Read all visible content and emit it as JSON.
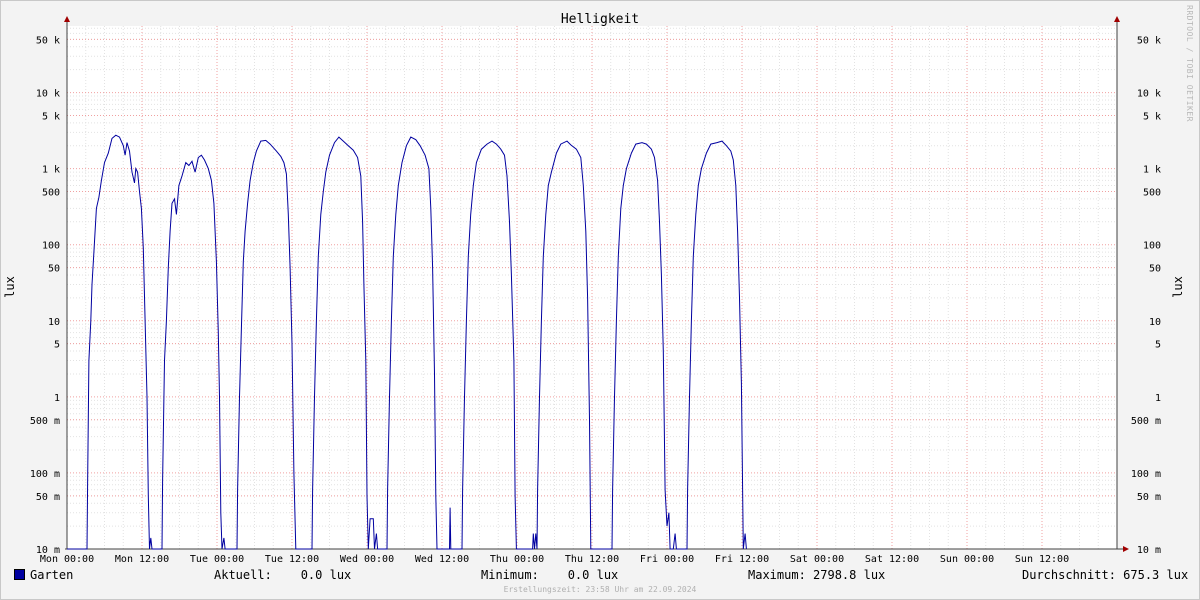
{
  "chart_data": {
    "type": "line",
    "title": "Helligkeit",
    "ylabel": "lux",
    "yscale": "log",
    "ylim": [
      10,
      75000
    ],
    "xlim": [
      0,
      168
    ],
    "y_ticks": [
      {
        "v": 10,
        "label": "10 m"
      },
      {
        "v": 50,
        "label": "50 m"
      },
      {
        "v": 100,
        "label": "100 m"
      },
      {
        "v": 500,
        "label": "500 m"
      },
      {
        "v": 1000,
        "label": "1"
      },
      {
        "v": 5000,
        "label": "5"
      },
      {
        "v": 10000,
        "label": "10"
      },
      {
        "v": 50000,
        "label": "50"
      },
      {
        "v": 100000,
        "label": "100"
      },
      {
        "v": 500000,
        "label": "500"
      },
      {
        "v": 1000000,
        "label": "1 k"
      },
      {
        "v": 5000000,
        "label": "5 k"
      },
      {
        "v": 10000000,
        "label": "10 k"
      },
      {
        "v": 50000000,
        "label": "50 k"
      }
    ],
    "x_ticks": [
      {
        "h": 0,
        "label": "Mon 00:00"
      },
      {
        "h": 12,
        "label": "Mon 12:00"
      },
      {
        "h": 24,
        "label": "Tue 00:00"
      },
      {
        "h": 36,
        "label": "Tue 12:00"
      },
      {
        "h": 48,
        "label": "Wed 00:00"
      },
      {
        "h": 60,
        "label": "Wed 12:00"
      },
      {
        "h": 72,
        "label": "Thu 00:00"
      },
      {
        "h": 84,
        "label": "Thu 12:00"
      },
      {
        "h": 96,
        "label": "Fri 00:00"
      },
      {
        "h": 108,
        "label": "Fri 12:00"
      },
      {
        "h": 120,
        "label": "Sat 00:00"
      },
      {
        "h": 132,
        "label": "Sat 12:00"
      },
      {
        "h": 144,
        "label": "Sun 00:00"
      },
      {
        "h": 156,
        "label": "Sun 12:00"
      }
    ],
    "grid": true,
    "series": [
      {
        "name": "Garten",
        "color": "#0000a0",
        "points": [
          [
            0,
            0.01
          ],
          [
            3.2,
            0.01
          ],
          [
            3.3,
            0.07
          ],
          [
            3.5,
            3
          ],
          [
            3.8,
            10
          ],
          [
            4.0,
            30
          ],
          [
            4.3,
            80
          ],
          [
            4.7,
            300
          ],
          [
            5.1,
            420
          ],
          [
            5.5,
            700
          ],
          [
            6.0,
            1200
          ],
          [
            6.6,
            1600
          ],
          [
            7.2,
            2500
          ],
          [
            7.8,
            2750
          ],
          [
            8.4,
            2600
          ],
          [
            9.0,
            2000
          ],
          [
            9.3,
            1500
          ],
          [
            9.6,
            2200
          ],
          [
            10.0,
            1700
          ],
          [
            10.4,
            900
          ],
          [
            10.8,
            650
          ],
          [
            11.0,
            1000
          ],
          [
            11.3,
            900
          ],
          [
            11.6,
            500
          ],
          [
            11.9,
            300
          ],
          [
            12.2,
            90
          ],
          [
            12.5,
            10
          ],
          [
            12.8,
            1
          ],
          [
            13.0,
            0.05
          ],
          [
            13.2,
            0.01
          ],
          [
            13.4,
            0.014
          ],
          [
            13.6,
            0.01
          ],
          [
            15.2,
            0.01
          ],
          [
            15.3,
            0.08
          ],
          [
            15.6,
            3
          ],
          [
            15.9,
            10
          ],
          [
            16.2,
            50
          ],
          [
            16.5,
            150
          ],
          [
            16.8,
            350
          ],
          [
            17.2,
            400
          ],
          [
            17.5,
            250
          ],
          [
            17.9,
            600
          ],
          [
            18.4,
            800
          ],
          [
            19.0,
            1200
          ],
          [
            19.5,
            1100
          ],
          [
            20.0,
            1250
          ],
          [
            20.5,
            900
          ],
          [
            21.0,
            1400
          ],
          [
            21.5,
            1500
          ],
          [
            22.0,
            1300
          ],
          [
            22.6,
            1000
          ],
          [
            23.1,
            700
          ],
          [
            23.5,
            350
          ],
          [
            23.9,
            60
          ],
          [
            24.2,
            7
          ],
          [
            24.4,
            1
          ],
          [
            24.6,
            0.03
          ],
          [
            24.8,
            0.01
          ],
          [
            25.1,
            0.014
          ],
          [
            25.3,
            0.01
          ],
          [
            27.2,
            0.01
          ],
          [
            27.3,
            0.06
          ],
          [
            27.6,
            1
          ],
          [
            27.9,
            8
          ],
          [
            28.2,
            60
          ],
          [
            28.5,
            150
          ],
          [
            28.9,
            350
          ],
          [
            29.3,
            700
          ],
          [
            29.8,
            1200
          ],
          [
            30.3,
            1700
          ],
          [
            31.0,
            2300
          ],
          [
            31.8,
            2350
          ],
          [
            32.5,
            2100
          ],
          [
            33.5,
            1700
          ],
          [
            34.2,
            1450
          ],
          [
            34.7,
            1200
          ],
          [
            35.1,
            850
          ],
          [
            35.4,
            250
          ],
          [
            35.7,
            50
          ],
          [
            36.0,
            5
          ],
          [
            36.3,
            0.1
          ],
          [
            36.6,
            0.01
          ],
          [
            39.2,
            0.01
          ],
          [
            39.3,
            0.06
          ],
          [
            39.6,
            1
          ],
          [
            39.9,
            10
          ],
          [
            40.2,
            70
          ],
          [
            40.6,
            250
          ],
          [
            41.0,
            500
          ],
          [
            41.4,
            900
          ],
          [
            42.0,
            1500
          ],
          [
            42.8,
            2200
          ],
          [
            43.5,
            2600
          ],
          [
            44.2,
            2300
          ],
          [
            45.0,
            2000
          ],
          [
            45.8,
            1750
          ],
          [
            46.5,
            1400
          ],
          [
            47.0,
            800
          ],
          [
            47.3,
            200
          ],
          [
            47.5,
            30
          ],
          [
            47.8,
            3
          ],
          [
            48.0,
            0.05
          ],
          [
            48.2,
            0.01
          ],
          [
            48.5,
            0.025
          ],
          [
            49.0,
            0.025
          ],
          [
            49.2,
            0.01
          ],
          [
            49.5,
            0.016
          ],
          [
            49.7,
            0.01
          ],
          [
            51.2,
            0.01
          ],
          [
            51.3,
            0.06
          ],
          [
            51.6,
            1
          ],
          [
            51.9,
            10
          ],
          [
            52.2,
            70
          ],
          [
            52.6,
            250
          ],
          [
            53.0,
            600
          ],
          [
            53.6,
            1200
          ],
          [
            54.3,
            2000
          ],
          [
            55.0,
            2600
          ],
          [
            55.8,
            2400
          ],
          [
            56.5,
            2000
          ],
          [
            57.3,
            1500
          ],
          [
            57.9,
            1000
          ],
          [
            58.2,
            300
          ],
          [
            58.5,
            50
          ],
          [
            58.8,
            2
          ],
          [
            59.0,
            0.05
          ],
          [
            59.2,
            0.01
          ],
          [
            61.2,
            0.01
          ],
          [
            61.3,
            0.035
          ],
          [
            61.4,
            0.01
          ],
          [
            63.2,
            0.01
          ],
          [
            63.3,
            0.06
          ],
          [
            63.6,
            1
          ],
          [
            63.9,
            10
          ],
          [
            64.2,
            70
          ],
          [
            64.6,
            250
          ],
          [
            65.0,
            600
          ],
          [
            65.5,
            1200
          ],
          [
            66.3,
            1800
          ],
          [
            67.2,
            2100
          ],
          [
            68.0,
            2300
          ],
          [
            68.7,
            2100
          ],
          [
            69.4,
            1800
          ],
          [
            70.0,
            1500
          ],
          [
            70.4,
            800
          ],
          [
            70.8,
            200
          ],
          [
            71.1,
            40
          ],
          [
            71.5,
            3
          ],
          [
            71.7,
            0.05
          ],
          [
            71.9,
            0.01
          ],
          [
            74.5,
            0.01
          ],
          [
            74.6,
            0.016
          ],
          [
            74.8,
            0.01
          ],
          [
            75.0,
            0.016
          ],
          [
            75.2,
            0.01
          ],
          [
            75.2,
            0.01
          ],
          [
            75.3,
            0.06
          ],
          [
            75.6,
            1
          ],
          [
            75.9,
            10
          ],
          [
            76.2,
            70
          ],
          [
            76.6,
            250
          ],
          [
            77.0,
            600
          ],
          [
            77.5,
            900
          ],
          [
            78.3,
            1600
          ],
          [
            79.0,
            2100
          ],
          [
            80.0,
            2300
          ],
          [
            80.6,
            2050
          ],
          [
            81.5,
            1800
          ],
          [
            82.2,
            1400
          ],
          [
            82.6,
            600
          ],
          [
            83.0,
            150
          ],
          [
            83.3,
            20
          ],
          [
            83.6,
            0.5
          ],
          [
            83.8,
            0.01
          ],
          [
            84.0,
            0.01
          ],
          [
            87.2,
            0.01
          ],
          [
            87.3,
            0.06
          ],
          [
            87.6,
            1
          ],
          [
            87.9,
            10
          ],
          [
            88.2,
            70
          ],
          [
            88.6,
            300
          ],
          [
            89.0,
            600
          ],
          [
            89.5,
            1000
          ],
          [
            90.3,
            1600
          ],
          [
            91.0,
            2100
          ],
          [
            92.0,
            2200
          ],
          [
            92.7,
            2100
          ],
          [
            93.5,
            1800
          ],
          [
            94.0,
            1400
          ],
          [
            94.5,
            700
          ],
          [
            94.8,
            200
          ],
          [
            95.1,
            40
          ],
          [
            95.4,
            4
          ],
          [
            95.7,
            0.06
          ],
          [
            96.0,
            0.02
          ],
          [
            96.3,
            0.03
          ],
          [
            96.5,
            0.01
          ],
          [
            97.0,
            0.01
          ],
          [
            97.3,
            0.016
          ],
          [
            97.5,
            0.01
          ],
          [
            99.2,
            0.01
          ],
          [
            99.3,
            0.06
          ],
          [
            99.6,
            1
          ],
          [
            99.9,
            10
          ],
          [
            100.2,
            70
          ],
          [
            100.6,
            250
          ],
          [
            101.0,
            600
          ],
          [
            101.5,
            1000
          ],
          [
            102.3,
            1600
          ],
          [
            103.0,
            2100
          ],
          [
            104.0,
            2200
          ],
          [
            104.8,
            2300
          ],
          [
            105.5,
            2000
          ],
          [
            106.2,
            1700
          ],
          [
            106.6,
            1300
          ],
          [
            107.0,
            600
          ],
          [
            107.3,
            150
          ],
          [
            107.6,
            20
          ],
          [
            107.9,
            1.5
          ],
          [
            108.2,
            0.01
          ],
          [
            108.5,
            0.016
          ],
          [
            108.7,
            0.01
          ]
        ]
      }
    ],
    "legend": {
      "series_label": "Garten",
      "current": "Aktuell:    0.0 lux",
      "minimum": "Minimum:    0.0 lux",
      "maximum": "Maximum: 2798.8 lux",
      "average": "Durchschnitt: 675.3 lux"
    },
    "footer": "Erstellungszeit: 23:58 Uhr am 22.09.2024",
    "credit": "RRDTOOL / TOBI OETIKER"
  }
}
